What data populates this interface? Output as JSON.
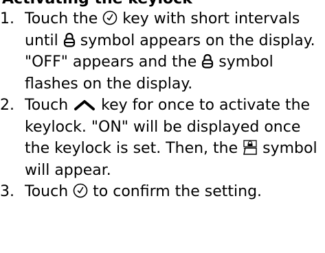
{
  "heading": "Activating the keylock",
  "steps": [
    {
      "number": "1.",
      "text_a": "Touch the",
      "icon_a": "clock-icon",
      "text_b": "key with short intervals until",
      "icon_b": "padlock-icon",
      "text_c": "symbol appears on the display. \"OFF\" appears and the",
      "icon_c": "padlock-icon",
      "text_d": "symbol flashes on the display."
    },
    {
      "number": "2.",
      "text_a": "Touch",
      "icon_a": "chevron-up-icon",
      "text_b": "key for once to activate the keylock. \"ON\" will be displayed once the keylock is set. Then, the",
      "icon_b": "keylock-display-icon",
      "text_c": "symbol will appear."
    },
    {
      "number": "3.",
      "text_a": "Touch",
      "icon_a": "clock-icon",
      "text_b": "to confirm the setting."
    }
  ]
}
